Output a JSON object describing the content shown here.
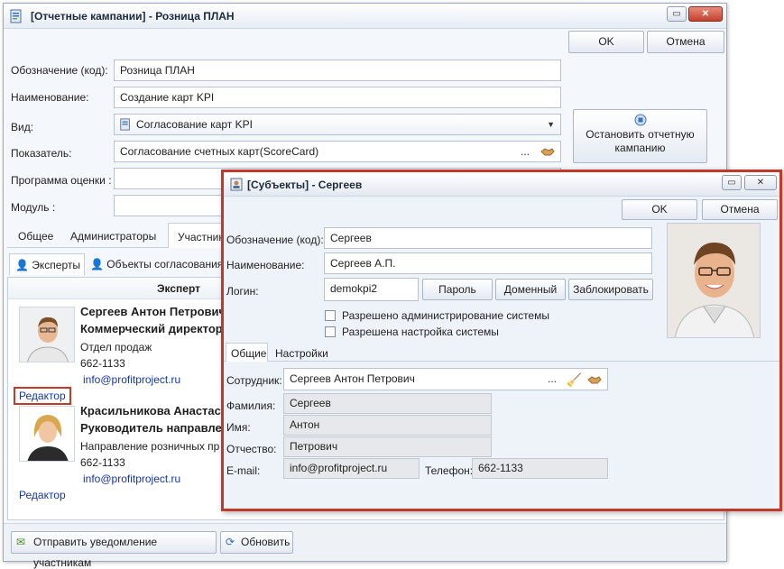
{
  "main": {
    "title": "[Отчетные кампании] - Розница ПЛАН",
    "ok": "OK",
    "cancel": "Отмена",
    "stop_button": "Остановить отчетную кампанию",
    "fields": {
      "code_label": "Обозначение (код):",
      "code_value": "Розница ПЛАН",
      "name_label": "Наименование:",
      "name_value": "Создание карт KPI",
      "type_label": "Вид:",
      "type_value": "Согласование карт KPI",
      "indicator_label": "Показатель:",
      "indicator_value": "Согласование счетных карт(ScoreCard)",
      "program_label": "Программа оценки :",
      "module_label": "Модуль :"
    },
    "tabs": [
      "Общее",
      "Администраторы",
      "Участник"
    ],
    "subtabs": [
      "Эксперты",
      "Объекты согласования"
    ],
    "column_header": "Эксперт",
    "experts": [
      {
        "name": "Сергеев Антон Петрович",
        "position": "Коммерческий директор",
        "department": "Отдел продаж",
        "phone": "662-1133",
        "email": "info@profitproject.ru",
        "editor": "Редактор"
      },
      {
        "name": "Красильникова Анастаси",
        "position": "Руководитель направлен",
        "department": "Направление розничных пр",
        "phone": "662-1133",
        "email": "info@profitproject.ru",
        "editor": "Редактор"
      }
    ],
    "notify_button": "Отправить уведомление участникам",
    "refresh_button": "Обновить"
  },
  "subject": {
    "title": "[Субъекты] - Сергеев",
    "ok": "OK",
    "cancel": "Отмена",
    "code_label": "Обозначение (код):",
    "code_value": "Сергеев",
    "name_label": "Наименование:",
    "name_value": "Сергеев А.П.",
    "login_label": "Логин:",
    "login_value": "demokpi2",
    "password_button": "Пароль",
    "domain_button": "Доменный",
    "block_button": "Заблокировать",
    "check_admin": "Разрешено администрирование системы",
    "check_settings": "Разрешена настройка системы",
    "tabs": [
      "Общие",
      "Настройки"
    ],
    "employee_label": "Сотрудник:",
    "employee_value": "Сергеев Антон Петрович",
    "surname_label": "Фамилия:",
    "surname_value": "Сергеев",
    "firstname_label": "Имя:",
    "firstname_value": "Антон",
    "patronymic_label": "Отчество:",
    "patronymic_value": "Петрович",
    "email_label": "E-mail:",
    "email_value": "info@profitproject.ru",
    "phone_label": "Телефон:",
    "phone_value": "662-1133"
  },
  "colors": {
    "accent_border": "#c0392b",
    "link": "#1336a8",
    "title_bg": "#e6ecf4"
  },
  "icons": [
    "campaign-icon",
    "subject-icon",
    "dropdown-arrow-icon",
    "handshake-icon",
    "broom-icon",
    "stop-icon",
    "expert-icon",
    "objects-icon",
    "notify-icon",
    "refresh-icon"
  ]
}
